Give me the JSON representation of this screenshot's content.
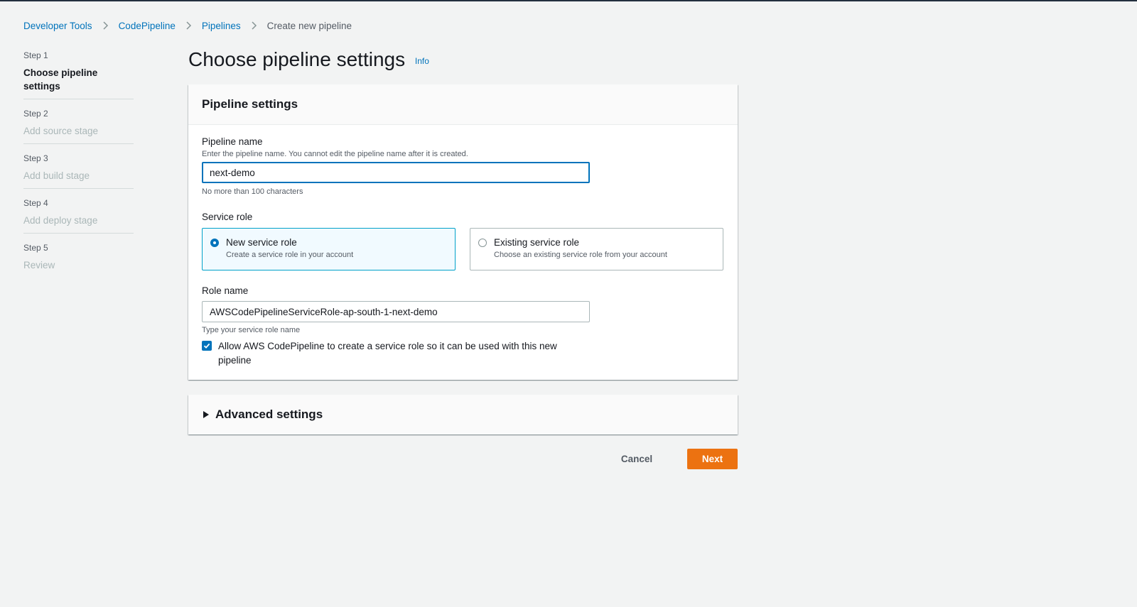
{
  "breadcrumb": {
    "items": [
      "Developer Tools",
      "CodePipeline",
      "Pipelines"
    ],
    "current": "Create new pipeline"
  },
  "steps": [
    {
      "number": "Step 1",
      "title": "Choose pipeline settings",
      "active": true
    },
    {
      "number": "Step 2",
      "title": "Add source stage",
      "active": false
    },
    {
      "number": "Step 3",
      "title": "Add build stage",
      "active": false
    },
    {
      "number": "Step 4",
      "title": "Add deploy stage",
      "active": false
    },
    {
      "number": "Step 5",
      "title": "Review",
      "active": false
    }
  ],
  "page": {
    "title": "Choose pipeline settings",
    "info": "Info"
  },
  "settings": {
    "header": "Pipeline settings",
    "pipeline_name": {
      "label": "Pipeline name",
      "description": "Enter the pipeline name. You cannot edit the pipeline name after it is created.",
      "value": "next-demo",
      "constraint": "No more than 100 characters"
    },
    "service_role": {
      "label": "Service role",
      "options": [
        {
          "title": "New service role",
          "description": "Create a service role in your account",
          "selected": true
        },
        {
          "title": "Existing service role",
          "description": "Choose an existing service role from your account",
          "selected": false
        }
      ]
    },
    "role_name": {
      "label": "Role name",
      "value": "AWSCodePipelineServiceRole-ap-south-1-next-demo",
      "hint": "Type your service role name"
    },
    "allow_checkbox": {
      "label": "Allow AWS CodePipeline to create a service role so it can be used with this new pipeline",
      "checked": true
    }
  },
  "advanced": {
    "title": "Advanced settings"
  },
  "actions": {
    "cancel": "Cancel",
    "next": "Next"
  },
  "colors": {
    "link": "#0073bb",
    "primary_button": "#ec7211",
    "background": "#f2f3f3",
    "selected_tile_bg": "#f1faff"
  }
}
